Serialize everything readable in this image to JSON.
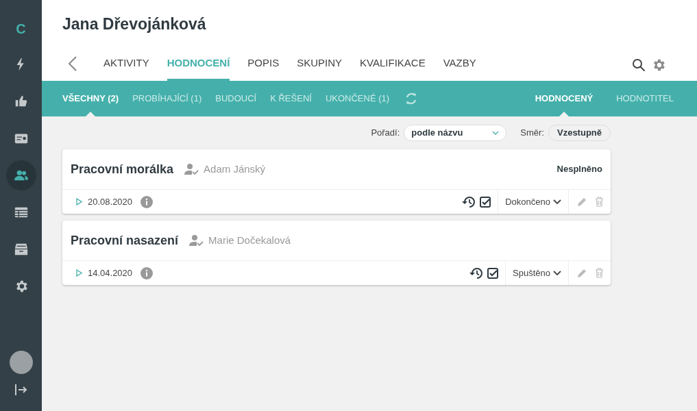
{
  "sidebar": {
    "logo": "C",
    "items": [
      {
        "kind": "bolt",
        "selected": false
      },
      {
        "kind": "thumbs-up",
        "selected": false
      },
      {
        "kind": "certificate",
        "selected": false
      },
      {
        "kind": "people",
        "selected": true
      },
      {
        "kind": "table",
        "selected": false
      },
      {
        "kind": "archive",
        "selected": false
      },
      {
        "kind": "gear",
        "selected": false
      }
    ]
  },
  "header": {
    "title": "Jana Dřevojánková"
  },
  "tabs": [
    {
      "label": "AKTIVITY",
      "selected": false
    },
    {
      "label": "HODNOCENÍ",
      "selected": true
    },
    {
      "label": "POPIS",
      "selected": false
    },
    {
      "label": "SKUPINY",
      "selected": false
    },
    {
      "label": "KVALIFIKACE",
      "selected": false
    },
    {
      "label": "VAZBY",
      "selected": false
    }
  ],
  "filters": [
    {
      "label": "VŠECHNY (2)",
      "selected": true
    },
    {
      "label": "PROBÍHAJÍCÍ (1)",
      "selected": false
    },
    {
      "label": "BUDOUCÍ",
      "selected": false
    },
    {
      "label": "K ŘEŠENÍ",
      "selected": false
    },
    {
      "label": "UKONČENÉ (1)",
      "selected": false
    }
  ],
  "roles": [
    {
      "label": "HODNOCENÝ",
      "selected": true
    },
    {
      "label": "HODNOTITEL",
      "selected": false
    }
  ],
  "sort": {
    "order_label": "Pořadí:",
    "order_value": "podle názvu",
    "direction_label": "Směr:",
    "direction_value": "Vzestupně"
  },
  "cards": [
    {
      "title": "Pracovní morálka",
      "person": "Adam Jánský",
      "result": "Nesplněno",
      "date": "20.08.2020",
      "status": "Dokončeno"
    },
    {
      "title": "Pracovní nasazení",
      "person": "Marie Dočekalová",
      "date": "14.04.2020",
      "status": "Spuštěno"
    }
  ]
}
